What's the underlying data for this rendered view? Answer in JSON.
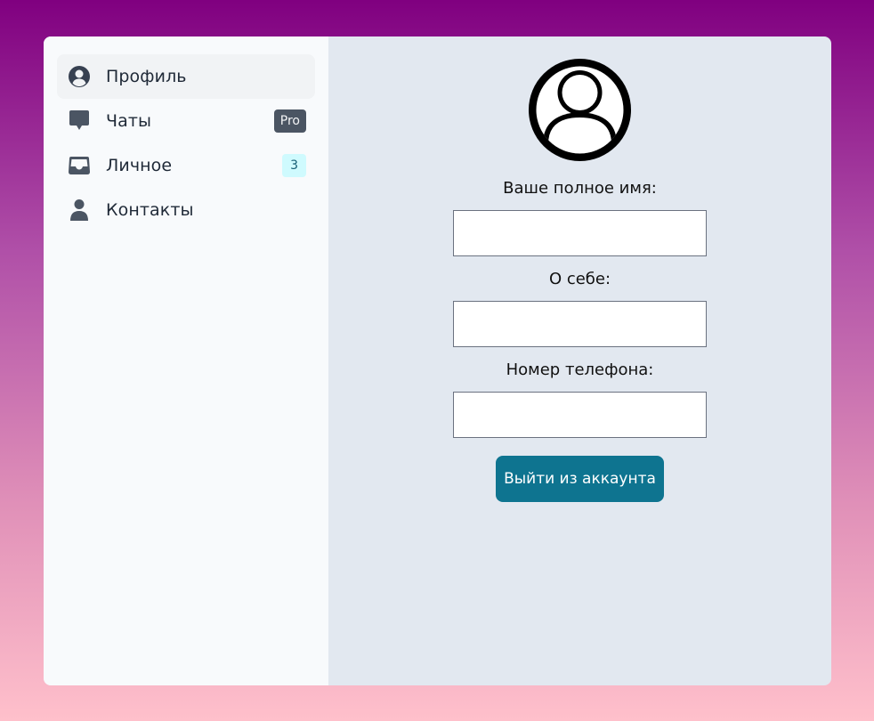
{
  "sidebar": {
    "items": [
      {
        "label": "Профиль",
        "icon": "user-circle-icon",
        "active": true
      },
      {
        "label": "Чаты",
        "icon": "chat-bubble-icon",
        "badge": "Pro"
      },
      {
        "label": "Личное",
        "icon": "inbox-icon",
        "badge": "3"
      },
      {
        "label": "Контакты",
        "icon": "user-icon"
      }
    ]
  },
  "profile": {
    "avatar_icon": "user-circle-icon",
    "fields": [
      {
        "label": "Ваше полное имя:",
        "value": "",
        "placeholder": ""
      },
      {
        "label": "О себе:",
        "value": "",
        "placeholder": ""
      },
      {
        "label": "Номер телефона:",
        "value": "",
        "placeholder": ""
      }
    ],
    "logout_label": "Выйти из аккаунта"
  },
  "colors": {
    "sidebar_bg": "#f8fafc",
    "main_bg": "#e2e8f0",
    "accent": "#0e7490",
    "badge_pro_bg": "#4b5563",
    "badge_count_bg": "#cffafe",
    "icon": "#4b5563"
  }
}
